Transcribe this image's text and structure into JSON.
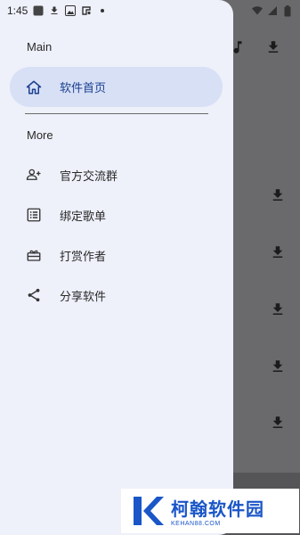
{
  "status_bar": {
    "time": "1:45"
  },
  "drawer": {
    "section_main": "Main",
    "selected_item": {
      "label": "软件首页",
      "icon": "home-icon"
    },
    "section_more": "More",
    "items": [
      {
        "label": "官方交流群",
        "icon": "group-add-icon"
      },
      {
        "label": "绑定歌单",
        "icon": "list-icon"
      },
      {
        "label": "打赏作者",
        "icon": "gift-icon"
      },
      {
        "label": "分享软件",
        "icon": "share-icon"
      }
    ]
  },
  "colors": {
    "drawer_bg": "#eef0fa",
    "selected_bg": "#d8e0f6",
    "accent": "#1a3f8f",
    "scrim": "#6a6a6d"
  },
  "watermark": {
    "name": "柯翰软件园",
    "domain": "KEHAN88.COM"
  }
}
